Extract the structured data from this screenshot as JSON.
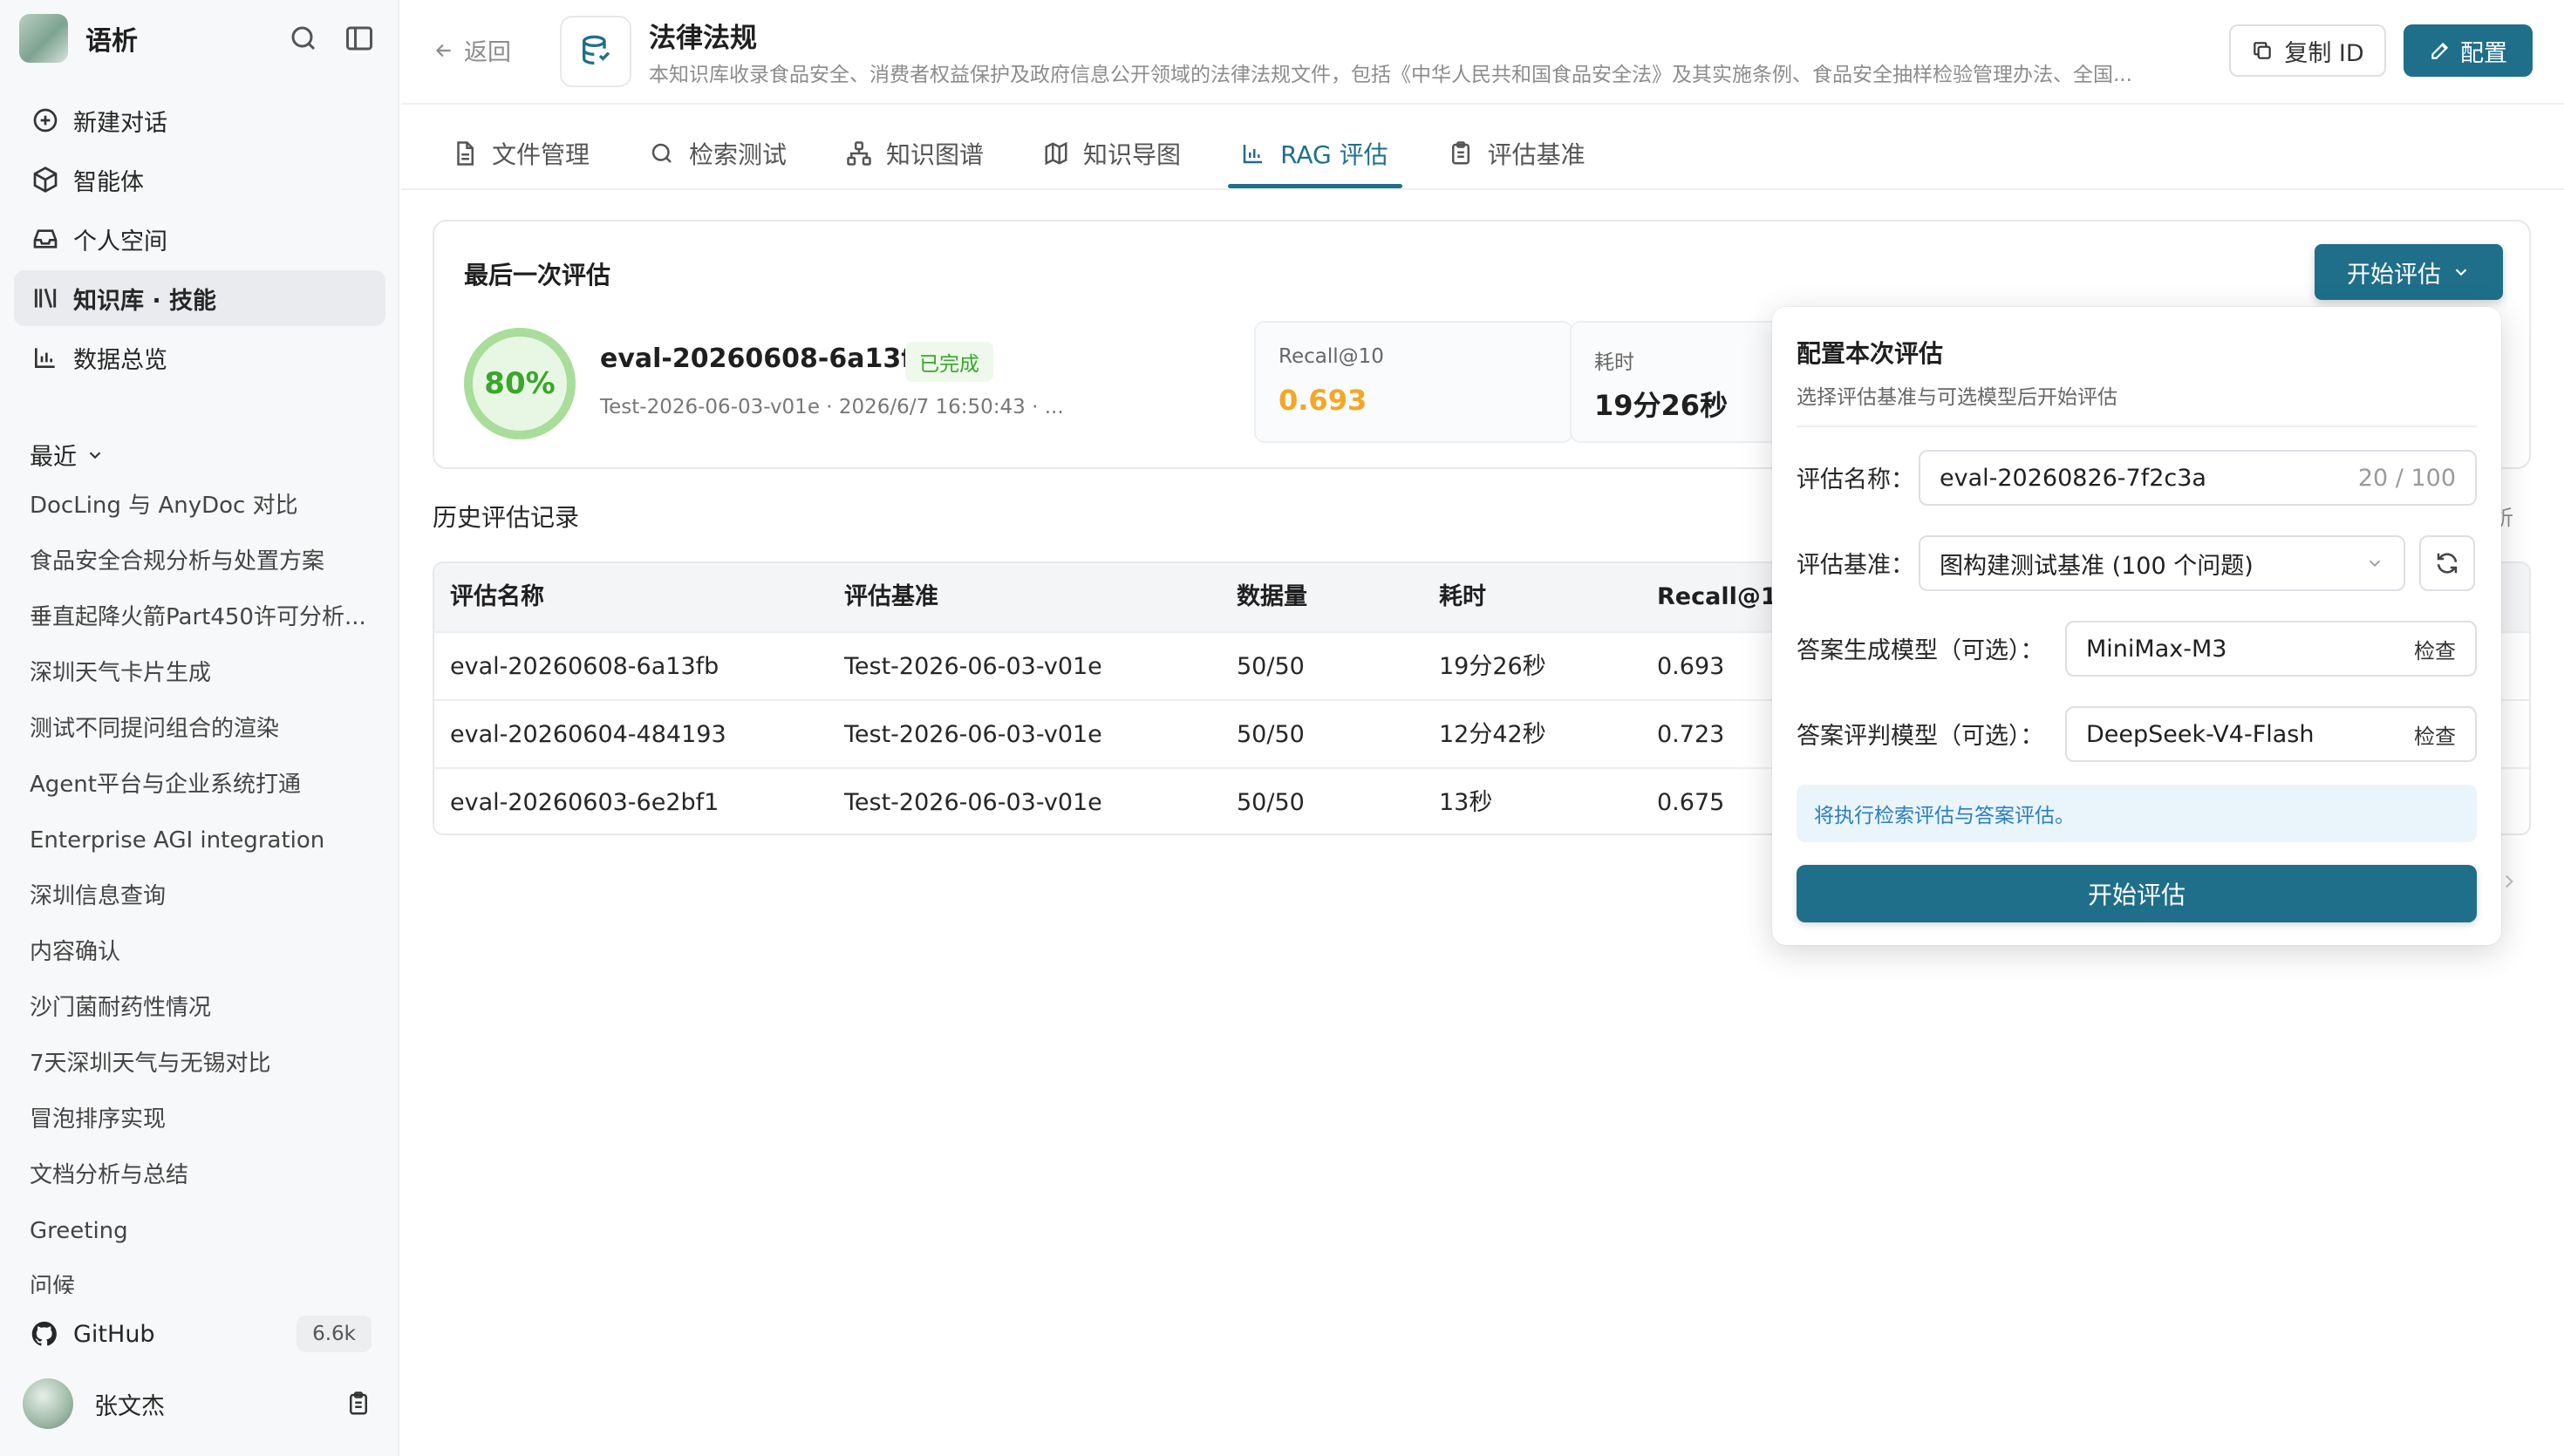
{
  "sidebar": {
    "brand": "语析",
    "nav": [
      {
        "label": "新建对话",
        "icon": "plus-circle-icon"
      },
      {
        "label": "智能体",
        "icon": "cube-icon"
      },
      {
        "label": "个人空间",
        "icon": "inbox-icon"
      },
      {
        "label": "知识库 · 技能",
        "icon": "library-icon"
      },
      {
        "label": "数据总览",
        "icon": "bar-chart-icon"
      }
    ],
    "recent_title": "最近",
    "recent": [
      "DocLing 与 AnyDoc 对比",
      "食品安全合规分析与处置方案",
      "垂直起降火箭Part450许可分析...",
      "深圳天气卡片生成",
      "测试不同提问组合的渲染",
      "Agent平台与企业系统打通",
      "Enterprise AGI integration",
      "深圳信息查询",
      "内容确认",
      "沙门菌耐药性情况",
      "7天深圳天气与无锡对比",
      "冒泡排序实现",
      "文档分析与总结",
      "Greeting",
      "问候"
    ],
    "github_label": "GitHub",
    "github_count": "6.6k",
    "user_name": "张文杰"
  },
  "header": {
    "back_label": "返回",
    "kb_title": "法律法规",
    "kb_desc": "本知识库收录食品安全、消费者权益保护及政府信息公开领域的法律法规文件，包括《中华人民共和国食品安全法》及其实施条例、食品安全抽样检验管理办法、全国...",
    "copy_id_label": "复制 ID",
    "config_label": "配置"
  },
  "tabs": [
    {
      "label": "文件管理",
      "icon": "file-icon"
    },
    {
      "label": "检索测试",
      "icon": "search-icon"
    },
    {
      "label": "知识图谱",
      "icon": "graph-icon"
    },
    {
      "label": "知识导图",
      "icon": "map-icon"
    },
    {
      "label": "RAG 评估",
      "icon": "bar-chart-icon",
      "active": true
    },
    {
      "label": "评估基准",
      "icon": "clipboard-icon"
    }
  ],
  "latest": {
    "title": "最后一次评估",
    "score": "80%",
    "score_fraction": 0.8,
    "name": "eval-20260608-6a13fb",
    "status": "已完成",
    "meta": "Test-2026-06-03-v01e · 2026/6/7 16:50:43 · ...",
    "metrics": [
      {
        "label": "Recall@10",
        "value": "0.693",
        "color": "#f5a623"
      },
      {
        "label": "耗时",
        "value": "19分26秒",
        "color": "#1f1f1f"
      }
    ],
    "start_button": "开始评估"
  },
  "history": {
    "title": "历史评估记录",
    "right_text": "析",
    "columns": [
      "评估名称",
      "评估基准",
      "数据量",
      "耗时",
      "Recall@10"
    ],
    "rows": [
      [
        "eval-20260608-6a13fb",
        "Test-2026-06-03-v01e",
        "50/50",
        "19分26秒",
        "0.693"
      ],
      [
        "eval-20260604-484193",
        "Test-2026-06-03-v01e",
        "50/50",
        "12分42秒",
        "0.723"
      ],
      [
        "eval-20260603-6e2bf1",
        "Test-2026-06-03-v01e",
        "50/50",
        "13秒",
        "0.675"
      ]
    ]
  },
  "popover": {
    "title": "配置本次评估",
    "subtitle": "选择评估基准与可选模型后开始评估",
    "name_label": "评估名称：",
    "name_value": "eval-20260826-7f2c3a",
    "name_count": "20 / 100",
    "benchmark_label": "评估基准：",
    "benchmark_value": "图构建测试基准 (100 个问题)",
    "answer_model_label": "答案生成模型（可选）：",
    "answer_model_value": "MiniMax-M3",
    "judge_model_label": "答案评判模型（可选）：",
    "judge_model_value": "DeepSeek-V4-Flash",
    "check_label": "检查",
    "info": "将执行检索评估与答案评估。",
    "start_label": "开始评估"
  },
  "colors": {
    "primary": "#1f6f8b",
    "success": "#3aa62a",
    "warning": "#f5a623",
    "info": "#2b7fbf"
  }
}
